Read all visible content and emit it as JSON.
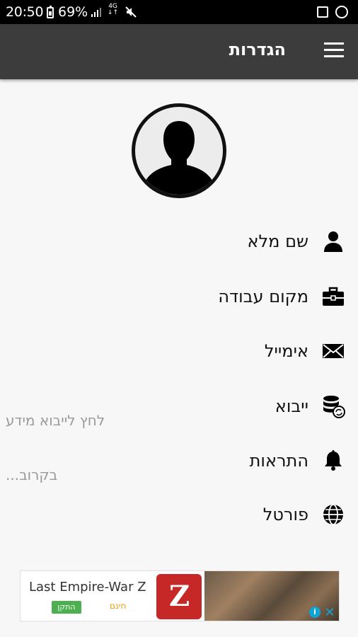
{
  "status_bar": {
    "time": "20:50",
    "battery": "69%",
    "network_type_top": "4G",
    "network_type_bottom": "↓↑"
  },
  "app_bar": {
    "title": "הגדרות",
    "menu_icon": "hamburger-icon"
  },
  "settings": {
    "items": [
      {
        "label": "שם מלא",
        "icon": "person-icon"
      },
      {
        "label": "מקום עבודה",
        "icon": "briefcase-icon"
      },
      {
        "label": "אימייל",
        "icon": "envelope-icon"
      },
      {
        "label": "ייבוא",
        "icon": "database-sync-icon",
        "hint": "לחץ לייבוא מידע"
      },
      {
        "label": "התראות",
        "icon": "bell-icon",
        "hint": "בקרוב..."
      },
      {
        "label": "פורטל",
        "icon": "globe-icon"
      }
    ]
  },
  "ad": {
    "title": "Last Empire-War Z",
    "install_label": "התקן",
    "price_label": "חינם",
    "logo_letter": "Z",
    "colors": {
      "install": "#4caf50",
      "price": "#f39c12",
      "adchoices": "#0fa3d8"
    }
  },
  "colors": {
    "app_bar": "#3c3c3c",
    "background": "#f7f7f7",
    "hint_text": "#9a9a9a"
  }
}
